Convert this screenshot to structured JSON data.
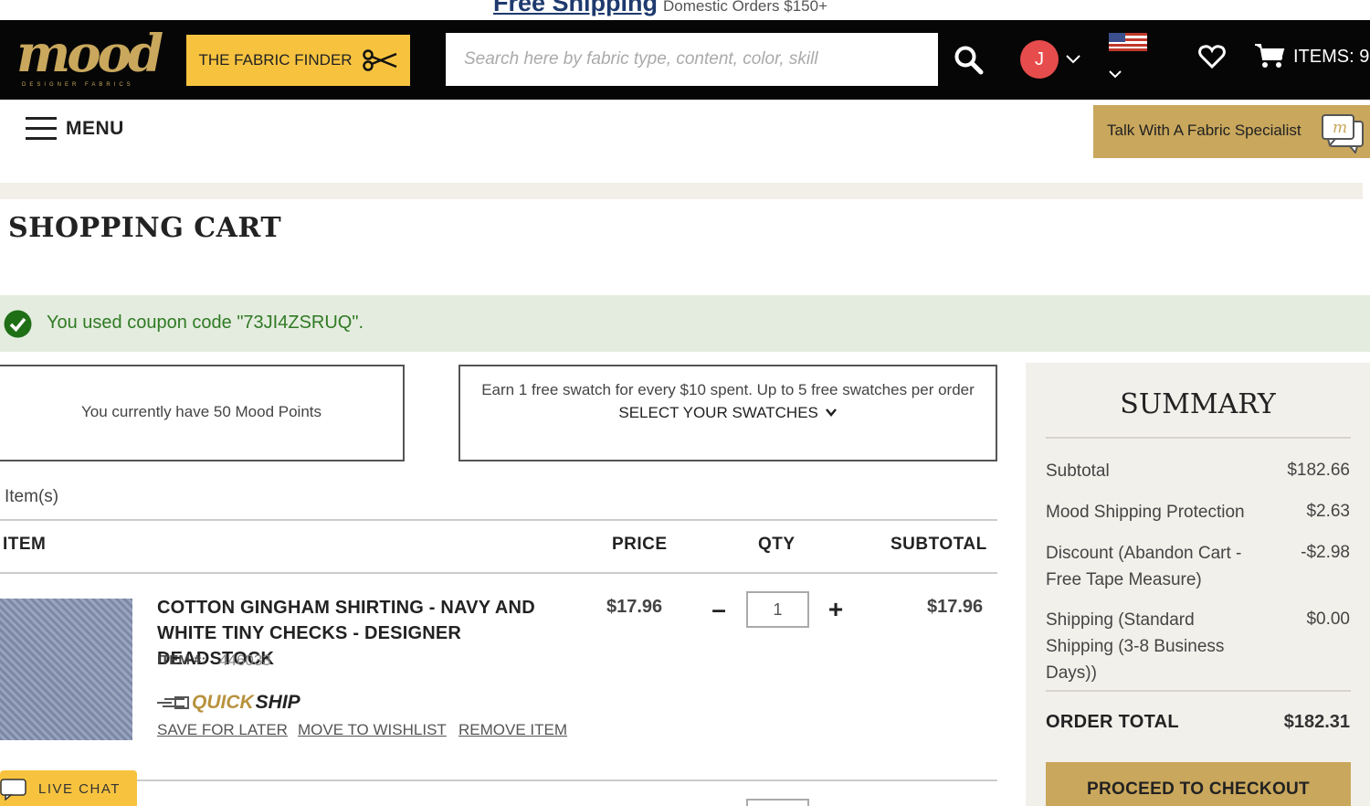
{
  "promo": {
    "highlight": "Free Shipping",
    "rest": "Domestic Orders $150+"
  },
  "header": {
    "logo_text": "mood",
    "logo_sub": "DESIGNER FABRICS",
    "fabric_finder_label": "THE FABRIC FINDER",
    "search_placeholder": "Search here by fabric type, content, color, skill",
    "avatar_initial": "J",
    "cart_items_label": "ITEMS: 9"
  },
  "nav": {
    "menu_label": "MENU",
    "specialist_label": "Talk With A Fabric Specialist"
  },
  "page": {
    "title": "SHOPPING CART",
    "coupon_message": "You used coupon code \"73JI4ZSRUQ\"."
  },
  "rewards": {
    "points_text": "You currently have 50 Mood Points",
    "swatch_text": "Earn 1 free swatch for every $10 spent. Up to 5 free swatches per order",
    "swatch_select_label": "SELECT YOUR SWATCHES"
  },
  "cart": {
    "items_label": "Item(s)",
    "columns": {
      "item": "ITEM",
      "price": "PRICE",
      "qty": "QTY",
      "subtotal": "SUBTOTAL"
    },
    "items": [
      {
        "name": "COTTON GINGHAM SHIRTING - NAVY AND WHITE TINY CHECKS - DESIGNER DEADSTOCK",
        "sku_label": "ITEM #:",
        "sku": "446033",
        "quickship_quick": "QUICK",
        "quickship_ship": "SHIP",
        "price": "$17.96",
        "qty": "1",
        "subtotal": "$17.96",
        "actions": {
          "save": "SAVE FOR LATER",
          "wishlist": "MOVE TO WISHLIST",
          "remove": "REMOVE ITEM"
        }
      }
    ]
  },
  "summary": {
    "title": "SUMMARY",
    "rows": [
      {
        "label": "Subtotal",
        "value": "$182.66"
      },
      {
        "label": "Mood Shipping Protection",
        "value": "$2.63"
      },
      {
        "label": "Discount (Abandon Cart - Free Tape Measure)",
        "value": "-$2.98"
      },
      {
        "label": "Shipping (Standard Shipping (3-8 Business Days))",
        "value": "$0.00"
      }
    ],
    "total_label": "ORDER TOTAL",
    "total_value": "$182.31",
    "checkout_label": "PROCEED TO CHECKOUT"
  },
  "live_chat_label": "LIVE CHAT",
  "colors": {
    "gold": "#c9a75c",
    "yellow": "#f7c33f",
    "success_green": "#2f7a23",
    "avatar_red": "#e74c4c"
  }
}
